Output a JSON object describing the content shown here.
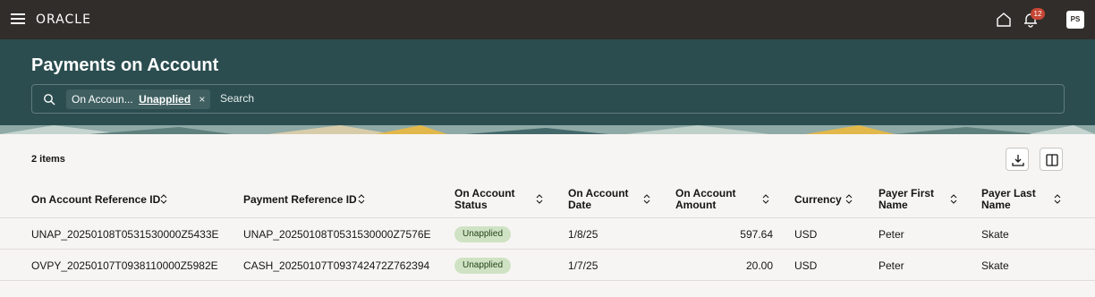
{
  "topbar": {
    "brand": "ORACLE",
    "notification_count": "12",
    "avatar_initials": "PS"
  },
  "header": {
    "title": "Payments on Account",
    "filter_chip": {
      "label": "On Accoun...",
      "value": "Unapplied",
      "close": "×"
    },
    "search_placeholder": "Search"
  },
  "table": {
    "items_count": "2 items",
    "columns": [
      {
        "label": "On Account Reference ID"
      },
      {
        "label": "Payment Reference ID"
      },
      {
        "label": "On Account\nStatus"
      },
      {
        "label": "On Account\nDate"
      },
      {
        "label": "On Account\nAmount"
      },
      {
        "label": "Currency"
      },
      {
        "label": "Payer First\nName"
      },
      {
        "label": "Payer Last\nName"
      }
    ],
    "rows": [
      {
        "on_account_ref": "UNAP_20250108T0531530000Z5433E",
        "payment_ref": "UNAP_20250108T0531530000Z7576E",
        "status": "Unapplied",
        "date": "1/8/25",
        "amount": "597.64",
        "currency": "USD",
        "first_name": "Peter",
        "last_name": "Skate"
      },
      {
        "on_account_ref": "OVPY_20250107T0938110000Z5982E",
        "payment_ref": "CASH_20250107T093742472Z762394",
        "status": "Unapplied",
        "date": "1/7/25",
        "amount": "20.00",
        "currency": "USD",
        "first_name": "Peter",
        "last_name": "Skate"
      }
    ]
  },
  "colors": {
    "topbar": "#312d2a",
    "hero": "#2b4d4f",
    "badge_bg": "#cfe3c4",
    "notification": "#c74634"
  },
  "icons": [
    "hamburger-icon",
    "home-icon",
    "bell-icon",
    "search-icon",
    "download-icon",
    "columns-icon",
    "sort-icon"
  ]
}
